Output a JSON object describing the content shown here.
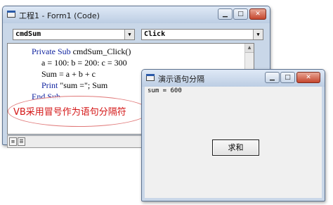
{
  "code_window": {
    "title": "工程1 - Form1 (Code)",
    "object_combo": "cmdSum",
    "proc_combo": "Click",
    "code_lines": [
      {
        "kw": "Private Sub",
        "text": " cmdSum_Click()"
      },
      {
        "kw": "",
        "text": "a = 100: b = 200: c = 300"
      },
      {
        "kw": "",
        "text": "Sum = a + b + c"
      },
      {
        "kw": "Print",
        "text": " \"sum =\"; Sum"
      },
      {
        "kw": "End Sub",
        "text": ""
      }
    ]
  },
  "annotation": {
    "text": "VB采用冒号作为语句分隔符",
    "color": "#d41616"
  },
  "run_window": {
    "title": "演示语句分隔",
    "output": "sum = 600",
    "button_label": "求和"
  },
  "caption_buttons": {
    "minimize": "▁",
    "maximize": "□",
    "close": "✕"
  }
}
